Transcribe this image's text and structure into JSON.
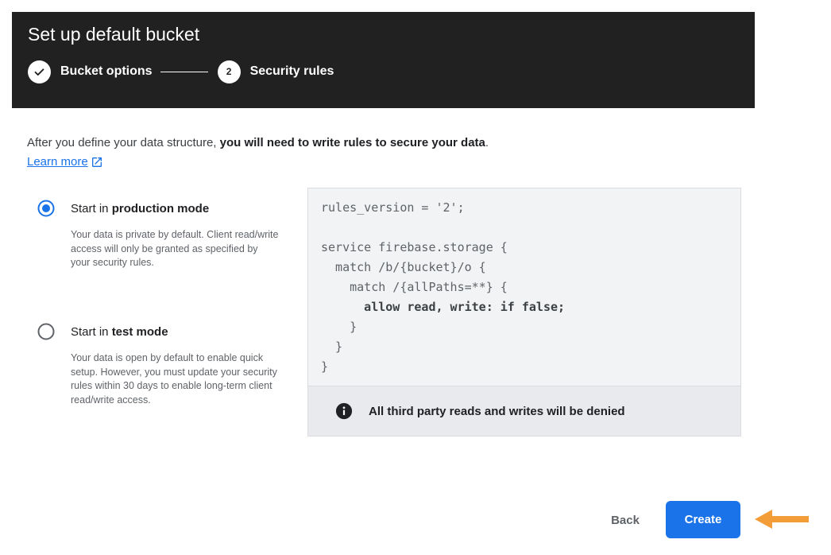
{
  "header": {
    "title": "Set up default bucket",
    "steps": [
      {
        "label": "Bucket options",
        "status": "complete",
        "icon": "check-icon"
      },
      {
        "label": "Security rules",
        "number": "2",
        "status": "current"
      }
    ]
  },
  "intro": {
    "text_before": "After you define your data structure, ",
    "text_bold": "you will need to write rules to secure your data",
    "text_after": ".",
    "learn_more": "Learn more",
    "learn_more_icon": "external-link-icon"
  },
  "options": [
    {
      "label_prefix": "Start in ",
      "label_bold": "production mode",
      "description": "Your data is private by default. Client read/write access will only be granted as specified by your security rules.",
      "selected": true
    },
    {
      "label_prefix": "Start in ",
      "label_bold": "test mode",
      "description": "Your data is open by default to enable quick setup. However, you must update your security rules within 30 days to enable long-term client read/write access.",
      "selected": false
    }
  ],
  "code": {
    "lines": [
      "rules_version = '2';",
      "",
      "service firebase.storage {",
      "  match /b/{bucket}/o {",
      "    match /{allPaths=**} {",
      "      allow read, write: if false;",
      "    }",
      "  }",
      "}"
    ],
    "highlighted_line": 5
  },
  "notice": {
    "icon": "info-icon",
    "text": "All third party reads and writes will be denied"
  },
  "footer": {
    "back_label": "Back",
    "create_label": "Create",
    "pointer_icon": "arrow-left-icon"
  },
  "colors": {
    "header_bg": "#212121",
    "accent": "#1a73e8",
    "code_panel_bg": "#f1f3f4",
    "notice_bg": "#e8eaed",
    "pointer_arrow": "#f29d38"
  }
}
